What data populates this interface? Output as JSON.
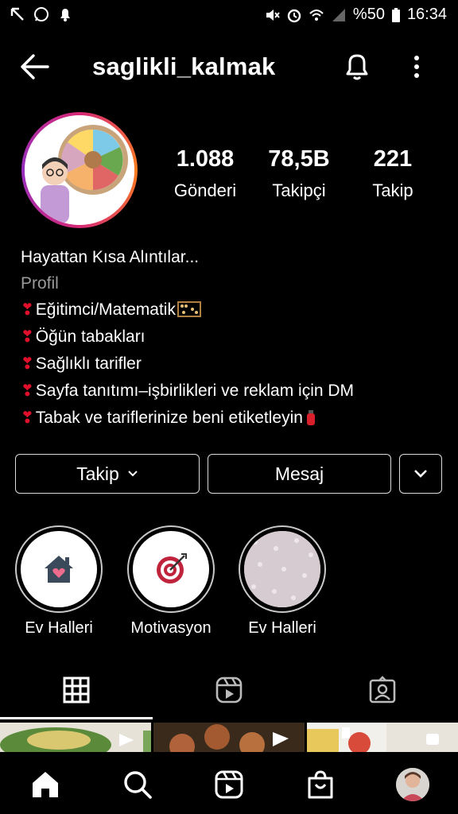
{
  "status_bar": {
    "battery": "%50",
    "time": "16:34"
  },
  "header": {
    "username": "saglikli_kalmak"
  },
  "stats": [
    {
      "value": "1.088",
      "label": "Gönderi"
    },
    {
      "value": "78,5B",
      "label": "Takipçi"
    },
    {
      "value": "221",
      "label": "Takip"
    }
  ],
  "bio": {
    "name": "Hayattan Kısa Alıntılar...",
    "category": "Profil",
    "lines": [
      "Eğitimci/Matematik",
      "Öğün tabakları",
      "Sağlıklı tarifler",
      "Sayfa tanıtımı–işbirlikleri ve reklam için DM",
      "Tabak ve tariflerinize beni etiketleyin"
    ]
  },
  "buttons": {
    "follow": "Takip",
    "message": "Mesaj"
  },
  "highlights": [
    {
      "label": "Ev Halleri",
      "icon": "house-heart-icon"
    },
    {
      "label": "Motivasyon",
      "icon": "target-icon"
    },
    {
      "label": "Ev Halleri",
      "icon": "pattern-icon"
    }
  ],
  "tabs": [
    "grid-icon",
    "reels-icon",
    "tagged-icon"
  ],
  "bottom_nav": [
    "home-icon",
    "search-icon",
    "reels-icon",
    "shop-icon",
    "profile-avatar"
  ],
  "colors": {
    "background": "#000000",
    "text": "#ffffff",
    "muted": "#9a9a9a",
    "heart": "#e0102c",
    "target": "#c0243c"
  }
}
